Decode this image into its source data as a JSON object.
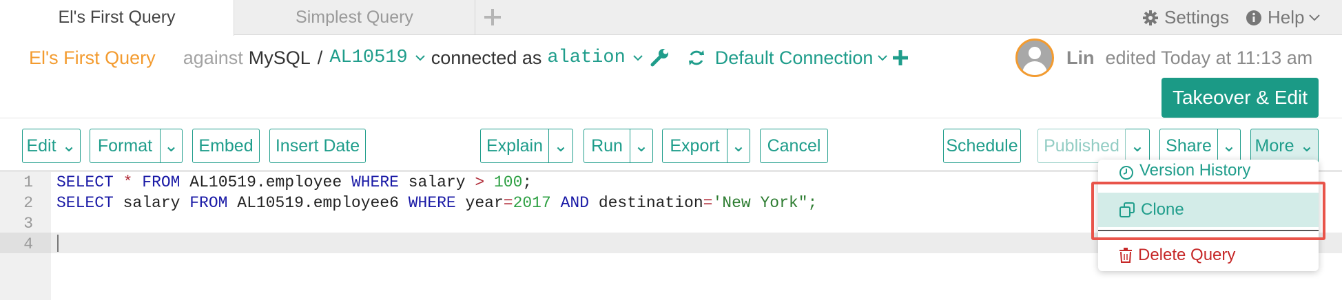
{
  "tabs": [
    {
      "label": "El's First Query",
      "active": true
    },
    {
      "label": "Simplest Query",
      "active": false
    }
  ],
  "topbar": {
    "settings_label": "Settings",
    "help_label": "Help"
  },
  "query": {
    "title": "El's First Query",
    "against_label": "against",
    "db_type": "MySQL",
    "separator": "/",
    "schema": "AL10519",
    "connected_as_label": "connected as",
    "user": "alation",
    "connection": "Default Connection"
  },
  "editor_user": {
    "name": "Lin",
    "edited_text": "edited Today at 11:13 am"
  },
  "takeover_button": "Takeover & Edit",
  "toolbar": {
    "edit": "Edit",
    "format": "Format",
    "embed": "Embed",
    "insert_date": "Insert Date",
    "explain": "Explain",
    "run": "Run",
    "export": "Export",
    "cancel": "Cancel",
    "schedule": "Schedule",
    "published": "Published",
    "share": "Share",
    "more": "More"
  },
  "code": {
    "line_numbers": [
      "1",
      "2",
      "3",
      "4"
    ],
    "lines": [
      "SELECT * FROM AL10519.employee WHERE salary > 100;",
      "SELECT salary FROM AL10519.employee6 WHERE year=2017 AND destination='New York\";",
      "",
      ""
    ]
  },
  "more_menu": {
    "items": [
      {
        "label": "Version History",
        "icon": "clock-icon"
      },
      {
        "label": "Clone",
        "icon": "copy-icon",
        "highlighted": true
      },
      {
        "label": "Delete Query",
        "icon": "trash-icon",
        "color": "#c62828"
      }
    ]
  },
  "colors": {
    "accent": "#1f9d8b",
    "title": "#f39b2f",
    "danger": "#c62828"
  }
}
